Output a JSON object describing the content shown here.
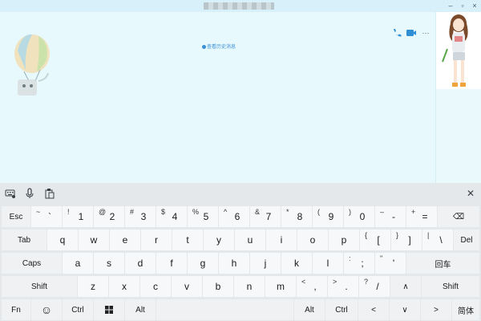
{
  "window": {
    "min_glyph": "–",
    "max_glyph": "▫",
    "close_glyph": "×"
  },
  "chat": {
    "history_link": "查看历史消息",
    "more_glyph": "···"
  },
  "keyboard": {
    "close_glyph": "✕",
    "row1": [
      {
        "label": "Esc"
      },
      {
        "top": "~",
        "main": "`"
      },
      {
        "top": "!",
        "main": "1"
      },
      {
        "top": "@",
        "main": "2"
      },
      {
        "top": "#",
        "main": "3"
      },
      {
        "top": "$",
        "main": "4"
      },
      {
        "top": "%",
        "main": "5"
      },
      {
        "top": "^",
        "main": "6"
      },
      {
        "top": "&",
        "main": "7"
      },
      {
        "top": "*",
        "main": "8"
      },
      {
        "top": "(",
        "main": "9"
      },
      {
        "top": ")",
        "main": "0"
      },
      {
        "top": "–",
        "main": "-"
      },
      {
        "top": "+",
        "main": "="
      },
      {
        "label": "⌫"
      }
    ],
    "row2": [
      {
        "label": "Tab"
      },
      {
        "main": "q"
      },
      {
        "main": "w"
      },
      {
        "main": "e"
      },
      {
        "main": "r"
      },
      {
        "main": "t"
      },
      {
        "main": "y"
      },
      {
        "main": "u"
      },
      {
        "main": "i"
      },
      {
        "main": "o"
      },
      {
        "main": "p"
      },
      {
        "top": "{",
        "main": "["
      },
      {
        "top": "}",
        "main": "]"
      },
      {
        "top": "|",
        "main": "\\"
      },
      {
        "label": "Del"
      }
    ],
    "row3": [
      {
        "label": "Caps"
      },
      {
        "main": "a"
      },
      {
        "main": "s"
      },
      {
        "main": "d"
      },
      {
        "main": "f"
      },
      {
        "main": "g"
      },
      {
        "main": "h"
      },
      {
        "main": "j"
      },
      {
        "main": "k"
      },
      {
        "main": "l"
      },
      {
        "top": ":",
        "main": ";"
      },
      {
        "top": "\"",
        "main": "'"
      },
      {
        "label": "回车"
      }
    ],
    "row4": [
      {
        "label": "Shift"
      },
      {
        "main": "z"
      },
      {
        "main": "x"
      },
      {
        "main": "c"
      },
      {
        "main": "v"
      },
      {
        "main": "b"
      },
      {
        "main": "n"
      },
      {
        "main": "m"
      },
      {
        "top": "<",
        "main": ","
      },
      {
        "top": ">",
        "main": "."
      },
      {
        "top": "?",
        "main": "/"
      },
      {
        "label": "∧"
      },
      {
        "label": "Shift"
      }
    ],
    "row5": [
      {
        "label": "Fn"
      },
      {
        "label": "☺"
      },
      {
        "label": "Ctrl"
      },
      {
        "label": "⊞"
      },
      {
        "label": "Alt"
      },
      {
        "label": ""
      },
      {
        "label": "Alt"
      },
      {
        "label": "Ctrl"
      },
      {
        "label": "<"
      },
      {
        "label": "∨"
      },
      {
        "label": ">"
      },
      {
        "label": "简体"
      }
    ]
  }
}
